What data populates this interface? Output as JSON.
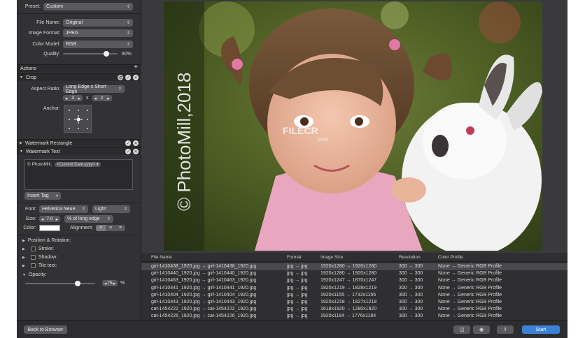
{
  "settings": {
    "preset_label": "Preset:",
    "preset_value": "Custom",
    "file_name_label": "File Name:",
    "file_name_value": "Original",
    "image_format_label": "Image Format:",
    "image_format_value": "JPEG",
    "color_model_label": "Color Model:",
    "color_model_value": "RGB",
    "quality_label": "Quality:",
    "quality_value": "80%",
    "quality_level": 0.8
  },
  "actions": {
    "header": "Actions",
    "add": "+",
    "crop": {
      "title": "Crop",
      "aspect_ratio_label": "Aspect Ratio:",
      "aspect_ratio_value": "Long Edge x Short Edge",
      "ratio_a": "3",
      "ratio_x": "x",
      "ratio_b": "2",
      "anchor_label": "Anchor:"
    },
    "watermark_rectangle": {
      "title": "Watermark Rectangle"
    },
    "watermark_text": {
      "title": "Watermark Text",
      "text_value": "© PhotoMill,",
      "tag_value": "<Current Date:yyyy>",
      "insert_tag": "Insert Tag",
      "font_label": "Font:",
      "font_value": "Helvetica Neue",
      "weight_value": "Light",
      "size_label": "Size:",
      "size_value": "7.0",
      "size_unit": "% of long edge",
      "color_label": "Color:",
      "alignment_label": "Alignment:",
      "position_label": "Position & Rotation:",
      "stroke_label": "Stroke:",
      "shadow_label": "Shadow:",
      "tile_label": "Tile text:",
      "opacity_label": "Opacity:",
      "opacity_value": "75",
      "opacity_unit": "%",
      "opacity_level": 0.75
    }
  },
  "preview": {
    "watermark": "© PhotoMill,2018",
    "overlay_logo": "FILECR",
    "overlay_sub": ".com"
  },
  "table": {
    "columns": [
      "File Name",
      "Format",
      "Image Size",
      "Resolution",
      "Color Profile"
    ],
    "rows": [
      [
        "girl-1410438_1920.jpg → girl-1410438_1920.jpg",
        "jpg → jpg",
        "1920x1280 → 1920x1280",
        "300 → 300",
        "None → Generic RGB Profile"
      ],
      [
        "girl-1410440_1920.jpg → girl-1410440_1920.jpg",
        "jpg → jpg",
        "1920x1280 → 1920x1280",
        "300 → 300",
        "None → Generic RGB Profile"
      ],
      [
        "girl-1410463_1920.jpg → girl-1410463_1920.jpg",
        "jpg → jpg",
        "1920x1247 → 1870x1247",
        "300 → 300",
        "None → Generic RGB Profile"
      ],
      [
        "girl-1410441_1920.jpg → girl-1410441_1920.jpg",
        "jpg → jpg",
        "1920x1219 → 1828x1219",
        "300 → 300",
        "None → Generic RGB Profile"
      ],
      [
        "girl-1410404_1920.jpg → girl-1410404_1920.jpg",
        "jpg → jpg",
        "1920x1155 → 1732x1155",
        "300 → 300",
        "None → Generic RGB Profile"
      ],
      [
        "girl-1410443_1920.jpg → girl-1410443_1920.jpg",
        "jpg → jpg",
        "1920x1218 → 1827x1218",
        "300 → 300",
        "None → Generic RGB Profile"
      ],
      [
        "cat-1454222_1920.jpg → cat-1454222_1920.jpg",
        "jpg → jpg",
        "1618x1920 → 1280x1920",
        "300 → 300",
        "None → Generic RGB Profile"
      ],
      [
        "cat-1454226_1920.jpg → cat-1454226_1920.jpg",
        "jpg → jpg",
        "1920x1184 → 1776x1184",
        "300 → 300",
        "None → Generic RGB Profile"
      ]
    ]
  },
  "footer": {
    "back_label": "Back to Browser",
    "start_label": "Start"
  },
  "colors": {
    "accent": "#3b82d6",
    "panel": "#323234",
    "selected_row": "#4a4a4d"
  }
}
